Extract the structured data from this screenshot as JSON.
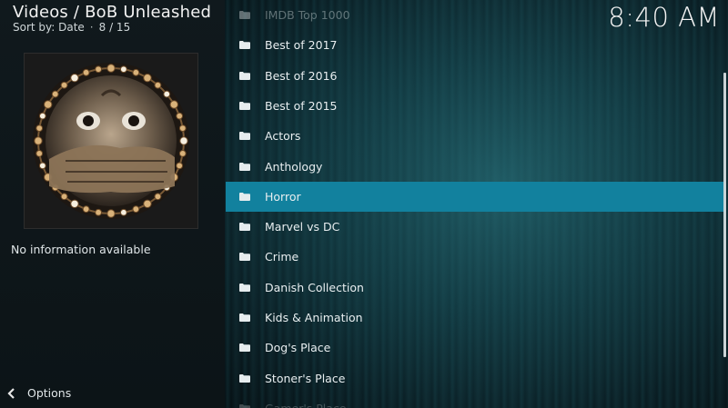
{
  "header": {
    "title": "Videos / BoB Unleashed",
    "sort": "Sort by: Date",
    "position": "8 / 15"
  },
  "clock": "8:40 AM",
  "info": {
    "text": "No information available"
  },
  "footer": {
    "options_label": "Options"
  },
  "list": {
    "items": [
      {
        "label": "IMDB Top 1000"
      },
      {
        "label": "Best of 2017"
      },
      {
        "label": "Best of 2016"
      },
      {
        "label": "Best of 2015"
      },
      {
        "label": "Actors"
      },
      {
        "label": "Anthology"
      },
      {
        "label": "Horror"
      },
      {
        "label": "Marvel vs DC"
      },
      {
        "label": "Crime"
      },
      {
        "label": "Danish Collection"
      },
      {
        "label": "Kids & Animation"
      },
      {
        "label": "Dog's Place"
      },
      {
        "label": "Stoner's Place"
      },
      {
        "label": "Gamer's Place"
      }
    ],
    "selected_index": 6
  },
  "colors": {
    "selection": "#12819e"
  },
  "icons": {
    "folder": "folder-icon",
    "options": "options-arrow-icon"
  }
}
